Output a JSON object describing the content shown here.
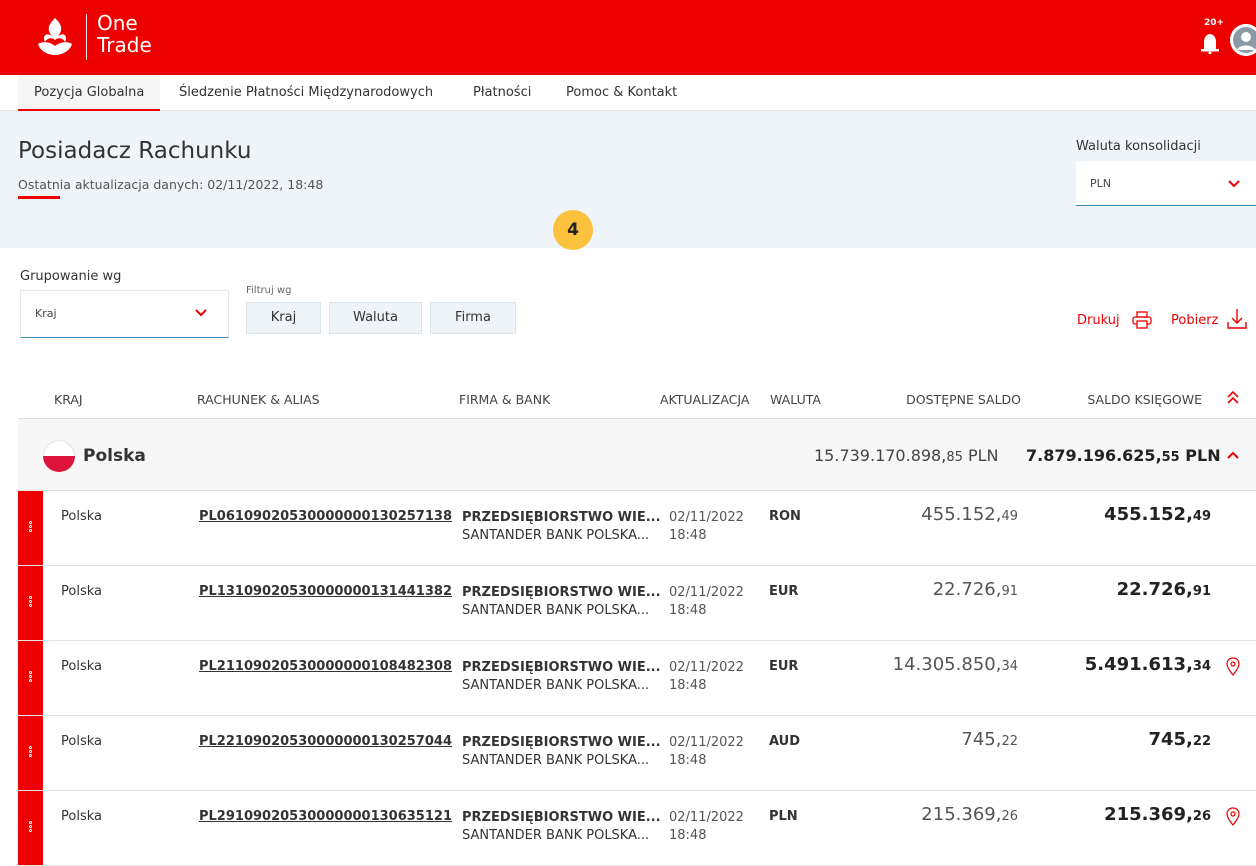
{
  "app": {
    "brand_line1": "One",
    "brand_line2": "Trade",
    "notifications_badge": "20+",
    "accent_color": "#ec0000"
  },
  "nav": {
    "tabs": [
      {
        "label": "Pozycja Globalna",
        "active": true
      },
      {
        "label": "Śledzenie Płatności Międzynarodowych",
        "active": false
      },
      {
        "label": "Płatności",
        "active": false
      },
      {
        "label": "Pomoc & Kontakt",
        "active": false
      }
    ]
  },
  "header": {
    "title": "Posiadacz Rachunku",
    "last_update": "Ostatnia aktualizacja danych: 02/11/2022, 18:48",
    "step_badge": "4",
    "consolidation_label": "Waluta konsolidacji",
    "consolidation_value": "PLN"
  },
  "filters": {
    "group_label": "Grupowanie wg",
    "group_value": "Kraj",
    "filter_label": "Filtruj wg",
    "filter_buttons": [
      "Kraj",
      "Waluta",
      "Firma"
    ],
    "print_label": "Drukuj",
    "download_label": "Pobierz"
  },
  "table": {
    "headers": {
      "country": "KRAJ",
      "account": "RACHUNEK & ALIAS",
      "firm": "FIRMA & BANK",
      "updated": "AKTUALIZACJA",
      "currency": "WALUTA",
      "available": "DOSTĘPNE SALDO",
      "book": "SALDO KSIĘGOWE"
    },
    "group": {
      "name": "Polska",
      "available_int": "15.739.170.898,",
      "available_dec": "85",
      "available_cur": " PLN",
      "book_int": "7.879.196.625,",
      "book_dec": "55",
      "book_cur": " PLN"
    },
    "rows": [
      {
        "country": "Polska",
        "account": "PL06109020530000000130257138",
        "firm": "PRZEDSIĘBIORSTWO WIE...",
        "bank": "SANTANDER BANK POLSKA...",
        "date": "02/11/2022",
        "time": "18:48",
        "currency": "RON",
        "available_int": "455.152,",
        "available_dec": "49",
        "book_int": "455.152,",
        "book_dec": "49",
        "pin": false
      },
      {
        "country": "Polska",
        "account": "PL13109020530000000131441382",
        "firm": "PRZEDSIĘBIORSTWO WIE...",
        "bank": "SANTANDER BANK POLSKA...",
        "date": "02/11/2022",
        "time": "18:48",
        "currency": "EUR",
        "available_int": "22.726,",
        "available_dec": "91",
        "book_int": "22.726,",
        "book_dec": "91",
        "pin": false
      },
      {
        "country": "Polska",
        "account": "PL21109020530000000108482308",
        "firm": "PRZEDSIĘBIORSTWO WIE...",
        "bank": "SANTANDER BANK POLSKA...",
        "date": "02/11/2022",
        "time": "18:48",
        "currency": "EUR",
        "available_int": "14.305.850,",
        "available_dec": "34",
        "book_int": "5.491.613,",
        "book_dec": "34",
        "pin": true
      },
      {
        "country": "Polska",
        "account": "PL22109020530000000130257044",
        "firm": "PRZEDSIĘBIORSTWO WIE...",
        "bank": "SANTANDER BANK POLSKA...",
        "date": "02/11/2022",
        "time": "18:48",
        "currency": "AUD",
        "available_int": "745,",
        "available_dec": "22",
        "book_int": "745,",
        "book_dec": "22",
        "pin": false
      },
      {
        "country": "Polska",
        "account": "PL29109020530000000130635121",
        "firm": "PRZEDSIĘBIORSTWO WIE...",
        "bank": "SANTANDER BANK POLSKA...",
        "date": "02/11/2022",
        "time": "18:48",
        "currency": "PLN",
        "available_int": "215.369,",
        "available_dec": "26",
        "book_int": "215.369,",
        "book_dec": "26",
        "pin": true
      }
    ]
  }
}
